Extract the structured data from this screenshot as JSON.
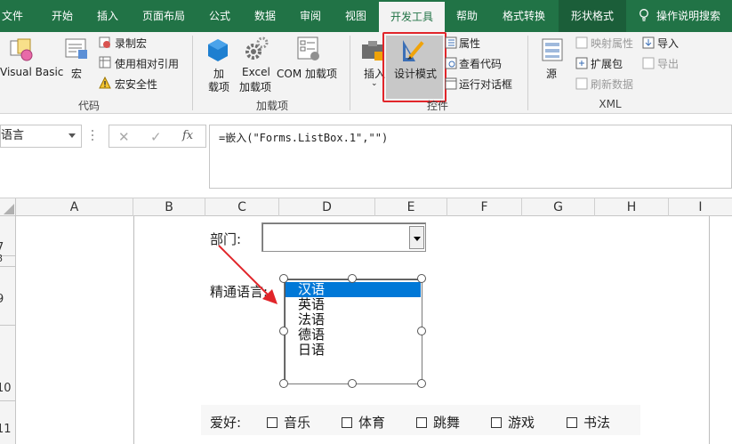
{
  "tabs": {
    "file": "文件",
    "home": "开始",
    "insert": "插入",
    "page_layout": "页面布局",
    "formulas": "公式",
    "data": "数据",
    "review": "审阅",
    "view": "视图",
    "developer": "开发工具",
    "help": "帮助",
    "format_convert": "格式转换",
    "shape_format": "形状格式",
    "search": "操作说明搜索"
  },
  "ribbon": {
    "code": {
      "visual_basic": "Visual Basic",
      "macros": "宏",
      "record_macro": "录制宏",
      "relative_refs": "使用相对引用",
      "macro_security": "宏安全性",
      "group_label": "代码"
    },
    "addins": {
      "addins_l1": "加",
      "addins_l2": "载项",
      "excel_l1": "Excel",
      "excel_l2": "加载项",
      "com": "COM 加载项",
      "group_label": "加载项"
    },
    "controls": {
      "insert": "插入",
      "design_mode": "设计模式",
      "properties": "属性",
      "view_code": "查看代码",
      "run_dialog": "运行对话框",
      "group_label": "控件"
    },
    "xml": {
      "source": "源",
      "map_props": "映射属性",
      "expansion": "扩展包",
      "refresh": "刷新数据",
      "import": "导入",
      "export": "导出",
      "group_label": "XML"
    }
  },
  "formula_bar": {
    "name_box": "语言",
    "formula": "=嵌入(\"Forms.ListBox.1\",\"\")"
  },
  "columns": [
    "A",
    "B",
    "C",
    "D",
    "E",
    "F",
    "G",
    "H",
    "I"
  ],
  "rows": [
    "7",
    "8",
    "9",
    "10",
    "11"
  ],
  "form": {
    "dept_label": "部门:",
    "lang_label": "精通语言:",
    "languages": [
      "汉语",
      "英语",
      "法语",
      "德语",
      "日语"
    ],
    "selected_language": "汉语",
    "hobby_label": "爱好:",
    "hobbies": [
      "音乐",
      "体育",
      "跳舞",
      "游戏",
      "书法"
    ]
  },
  "colors": {
    "excel_green": "#217346",
    "selection_blue": "#0078d7",
    "highlight_red": "#e1252a"
  }
}
